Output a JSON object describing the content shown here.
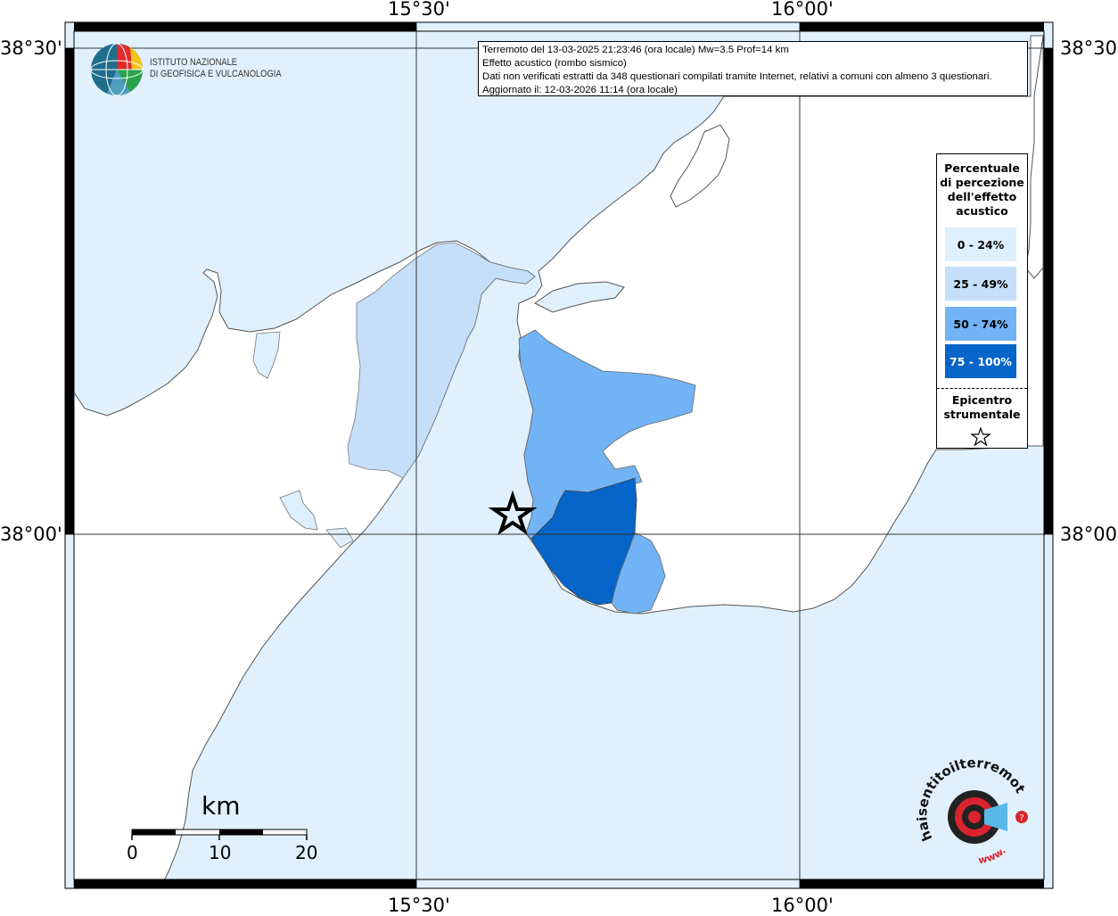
{
  "header": {
    "line1": "Terremoto del 13-03-2025 21:23:46 (ora locale) Mw=3.5 Prof=14 km",
    "line2": "Effetto acustico (rombo sismico)",
    "line3": "Dati non verificati estratti da 348 questionari compilati tramite Internet, relativi a comuni con almeno 3 questionari.",
    "line4": "Aggiornato il: 12-03-2026 11:14 (ora locale)"
  },
  "logo": {
    "line1": "ISTITUTO NAZIONALE",
    "line2": "DI GEOFISICA E VULCANOLOGIA"
  },
  "axes": {
    "lon_left": "15°30'",
    "lon_right": "16°00'",
    "lat_top": "38°30'",
    "lat_bottom": "38°00'"
  },
  "legend": {
    "title_l1": "Percentuale",
    "title_l2": "di percezione",
    "title_l3": "dell'effetto",
    "title_l4": "acustico",
    "classes": [
      {
        "label": "0 - 24%",
        "color": "#deeffd"
      },
      {
        "label": "25 - 49%",
        "color": "#c5dffa"
      },
      {
        "label": "50 - 74%",
        "color": "#72b3f6"
      },
      {
        "label": "75 - 100%",
        "color": "#0565c9"
      }
    ],
    "epi_l1": "Epicentro",
    "epi_l2": "strumentale"
  },
  "scale": {
    "unit": "km",
    "ticks": [
      "0",
      "10",
      "20"
    ]
  },
  "watermark": {
    "text": "haisentitoilterremoto.it",
    "www": "www."
  },
  "colors": {
    "sea": "#e0f1fd",
    "land": "#ffffff",
    "class_0_24": "#deeffd",
    "class_25_49": "#c5dffa",
    "class_50_74": "#72b3f6",
    "class_75_100": "#0565c9",
    "watermark_red": "#d9232e"
  }
}
